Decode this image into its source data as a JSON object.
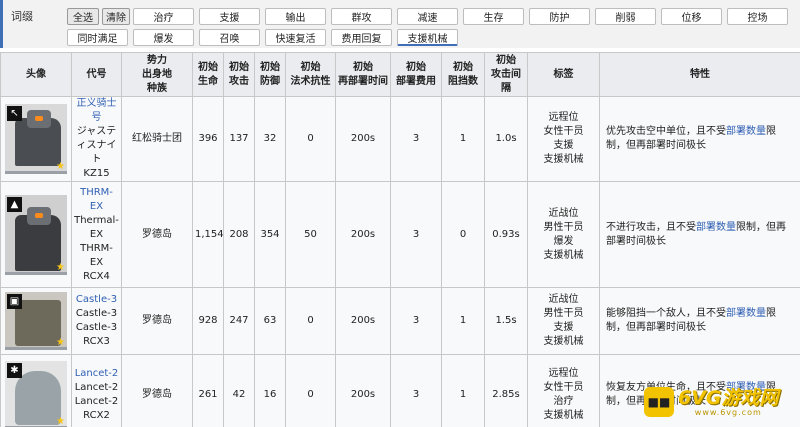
{
  "filter": {
    "title": "词缀",
    "select_all": "全选",
    "clear": "清除",
    "tags_row1": [
      "治疗",
      "支援",
      "输出",
      "群攻",
      "减速",
      "生存",
      "防护",
      "削弱",
      "位移",
      "控场"
    ],
    "tags_row2": [
      "同时满足",
      "爆发",
      "召唤",
      "快速复活",
      "费用回复",
      "支援机械"
    ],
    "active_tag": "支援机械"
  },
  "table": {
    "headers": {
      "avatar": "头像",
      "code": "代号",
      "faction_l1": "势力",
      "faction_l2": "出身地",
      "faction_l3": "种族",
      "hp_l1": "初始",
      "hp_l2": "生命",
      "atk_l1": "初始",
      "atk_l2": "攻击",
      "def_l1": "初始",
      "def_l2": "防御",
      "res_l1": "初始",
      "res_l2": "法术抗性",
      "redeploy_l1": "初始",
      "redeploy_l2": "再部署时间",
      "cost_l1": "初始",
      "cost_l2": "部署费用",
      "block_l1": "初始",
      "block_l2": "阻挡数",
      "interval_l1": "初始",
      "interval_l2": "攻击间隔",
      "tags": "标签",
      "traits": "特性"
    },
    "rows": [
      {
        "icon": "snipe-class-icon",
        "name_link": "正义骑士号",
        "code_lines": [
          "ジャスティスナイト",
          "KZ15"
        ],
        "faction": "红松骑士团",
        "hp": "396",
        "atk": "137",
        "def": "32",
        "res": "0",
        "redeploy": "200s",
        "cost": "3",
        "block": "1",
        "interval": "1.0s",
        "tags": [
          "远程位",
          "女性干员",
          "支援",
          "支援机械"
        ],
        "trait_pre": "优先攻击空中单位，且不受",
        "trait_link": "部署数量",
        "trait_post": "限制，但再部署时间极长"
      },
      {
        "icon": "guard-class-icon",
        "name_link": "THRM-EX",
        "code_lines": [
          "Thermal-EX",
          "THRM-EX",
          "RCX4"
        ],
        "faction": "罗德岛",
        "hp": "1,154",
        "atk": "208",
        "def": "354",
        "res": "50",
        "redeploy": "200s",
        "cost": "3",
        "block": "0",
        "interval": "0.93s",
        "tags": [
          "近战位",
          "男性干员",
          "爆发",
          "支援机械"
        ],
        "trait_pre": "不进行攻击，且不受",
        "trait_link": "部署数量",
        "trait_post": "限制，但再部署时间极长"
      },
      {
        "icon": "defender-class-icon",
        "name_link": "Castle-3",
        "code_lines": [
          "Castle-3",
          "Castle-3",
          "RCX3"
        ],
        "faction": "罗德岛",
        "hp": "928",
        "atk": "247",
        "def": "63",
        "res": "0",
        "redeploy": "200s",
        "cost": "3",
        "block": "1",
        "interval": "1.5s",
        "tags": [
          "近战位",
          "男性干员",
          "支援",
          "支援机械"
        ],
        "trait_pre": "能够阻挡一个敌人，且不受",
        "trait_link": "部署数量",
        "trait_post": "限制，但再部署时间极长"
      },
      {
        "icon": "medic-class-icon",
        "name_link": "Lancet-2",
        "code_lines": [
          "Lancet-2",
          "Lancet-2",
          "RCX2"
        ],
        "faction": "罗德岛",
        "hp": "261",
        "atk": "42",
        "def": "16",
        "res": "0",
        "redeploy": "200s",
        "cost": "3",
        "block": "1",
        "interval": "2.85s",
        "tags": [
          "远程位",
          "女性干员",
          "治疗",
          "支援机械"
        ],
        "trait_pre": "恢复友方单位生命，且不受",
        "trait_link": "部署数量",
        "trait_post": "限制，但再部署时间极长"
      }
    ]
  },
  "watermark": {
    "badge": "■■",
    "name": "6VG游戏网",
    "url": "www.6vg.com"
  }
}
